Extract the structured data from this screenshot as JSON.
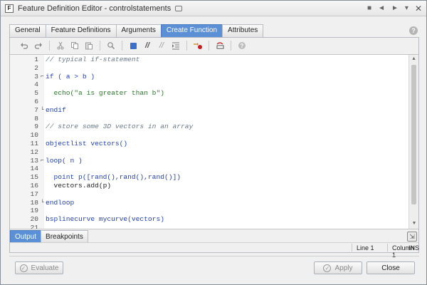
{
  "window": {
    "title": "Feature Definition Editor - controlstatements",
    "controls": [
      "■",
      "◄",
      "►",
      "▾",
      "✕"
    ]
  },
  "tabs": [
    {
      "label": "General",
      "active": false
    },
    {
      "label": "Feature Definitions",
      "active": false
    },
    {
      "label": "Arguments",
      "active": false
    },
    {
      "label": "Create Function",
      "active": true
    },
    {
      "label": "Attributes",
      "active": false
    }
  ],
  "help_icon": "?",
  "toolbar": {
    "icons": [
      "undo-icon",
      "redo-icon",
      "cut-icon",
      "copy-icon",
      "paste-icon",
      "find-icon",
      "bookmark-icon",
      "comment-icon",
      "uncomment-icon",
      "indent-icon",
      "breakpoint-icon",
      "step-icon",
      "help-icon"
    ],
    "comment_glyph": "//",
    "uncomment_glyph": "//"
  },
  "editor": {
    "lines": [
      {
        "n": "1",
        "fold": "",
        "code": "// typical if-statement",
        "type": "cm"
      },
      {
        "n": "2",
        "fold": "",
        "code": "",
        "type": "tx"
      },
      {
        "n": "3",
        "fold": "⌐",
        "code": "if ( a > b )",
        "type": "kw"
      },
      {
        "n": "4",
        "fold": "",
        "code": "",
        "type": "tx"
      },
      {
        "n": "5",
        "fold": "",
        "code": "  echo(\"a is greater than b\")",
        "type": "str"
      },
      {
        "n": "6",
        "fold": "",
        "code": "",
        "type": "tx"
      },
      {
        "n": "7",
        "fold": "└",
        "code": "endif",
        "type": "kw"
      },
      {
        "n": "8",
        "fold": "",
        "code": "",
        "type": "tx"
      },
      {
        "n": "9",
        "fold": "",
        "code": "// store some 3D vectors in an array",
        "type": "cm"
      },
      {
        "n": "10",
        "fold": "",
        "code": "",
        "type": "tx"
      },
      {
        "n": "11",
        "fold": "",
        "code": "objectlist vectors()",
        "type": "fn"
      },
      {
        "n": "12",
        "fold": "",
        "code": "",
        "type": "tx"
      },
      {
        "n": "13",
        "fold": "⌐",
        "code": "loop( n )",
        "type": "kw"
      },
      {
        "n": "14",
        "fold": "",
        "code": "",
        "type": "tx"
      },
      {
        "n": "15",
        "fold": "",
        "code": "  point p([rand(),rand(),rand()])",
        "type": "fn"
      },
      {
        "n": "16",
        "fold": "",
        "code": "  vectors.add(p)",
        "type": "tx"
      },
      {
        "n": "17",
        "fold": "",
        "code": "",
        "type": "tx"
      },
      {
        "n": "18",
        "fold": "└",
        "code": "endloop",
        "type": "kw"
      },
      {
        "n": "19",
        "fold": "",
        "code": "",
        "type": "tx"
      },
      {
        "n": "20",
        "fold": "",
        "code": "bsplinecurve mycurve(vectors)",
        "type": "fn"
      },
      {
        "n": "21",
        "fold": "",
        "code": "",
        "type": "tx"
      }
    ]
  },
  "bottom_tabs": [
    {
      "label": "Output",
      "active": true
    },
    {
      "label": "Breakpoints",
      "active": false
    }
  ],
  "status": {
    "line": "Line 1",
    "column": "Column 1",
    "mode": "INS"
  },
  "buttons": {
    "evaluate": "Evaluate",
    "apply": "Apply",
    "close": "Close"
  },
  "colors": {
    "accent": "#5b8fd6",
    "keyword": "#1f3fbf",
    "comment": "#6a7a8a",
    "breakpoint": "#c81d1d"
  }
}
